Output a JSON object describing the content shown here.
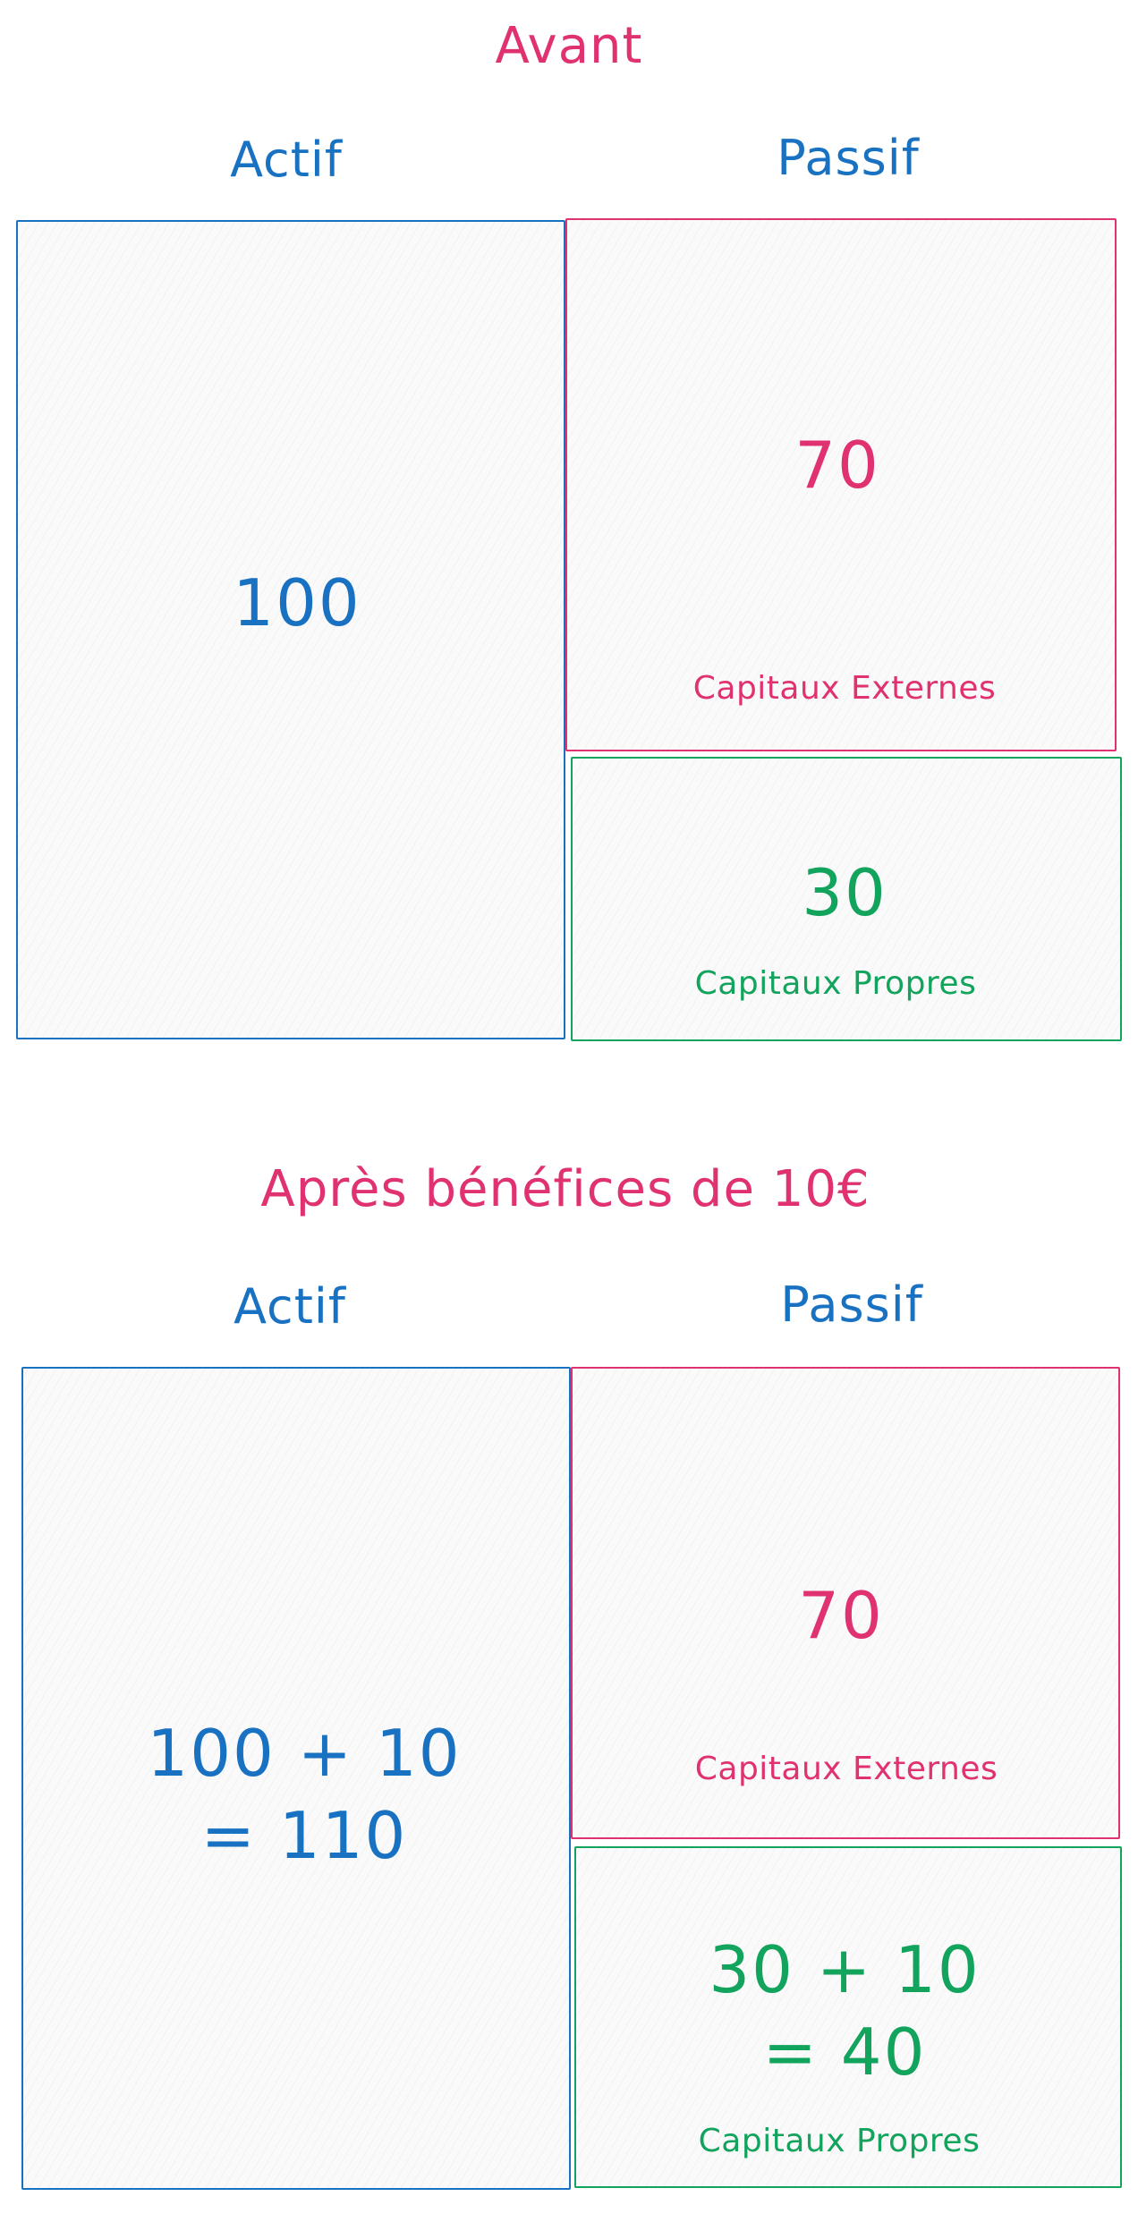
{
  "colors": {
    "blue": "#1971c2",
    "red": "#e03170",
    "green": "#12a35d"
  },
  "before": {
    "title": "Avant",
    "actif_label": "Actif",
    "passif_label": "Passif",
    "actif_value": "100",
    "externes_value": "70",
    "externes_label": "Capitaux Externes",
    "propres_value": "30",
    "propres_label": "Capitaux Propres"
  },
  "after": {
    "title": "Après bénéfices de 10€",
    "actif_label": "Actif",
    "passif_label": "Passif",
    "actif_line1": "100 + 10",
    "actif_line2": "= 110",
    "externes_value": "70",
    "externes_label": "Capitaux Externes",
    "propres_line1": "30 + 10",
    "propres_line2": "= 40",
    "propres_label": "Capitaux Propres"
  }
}
